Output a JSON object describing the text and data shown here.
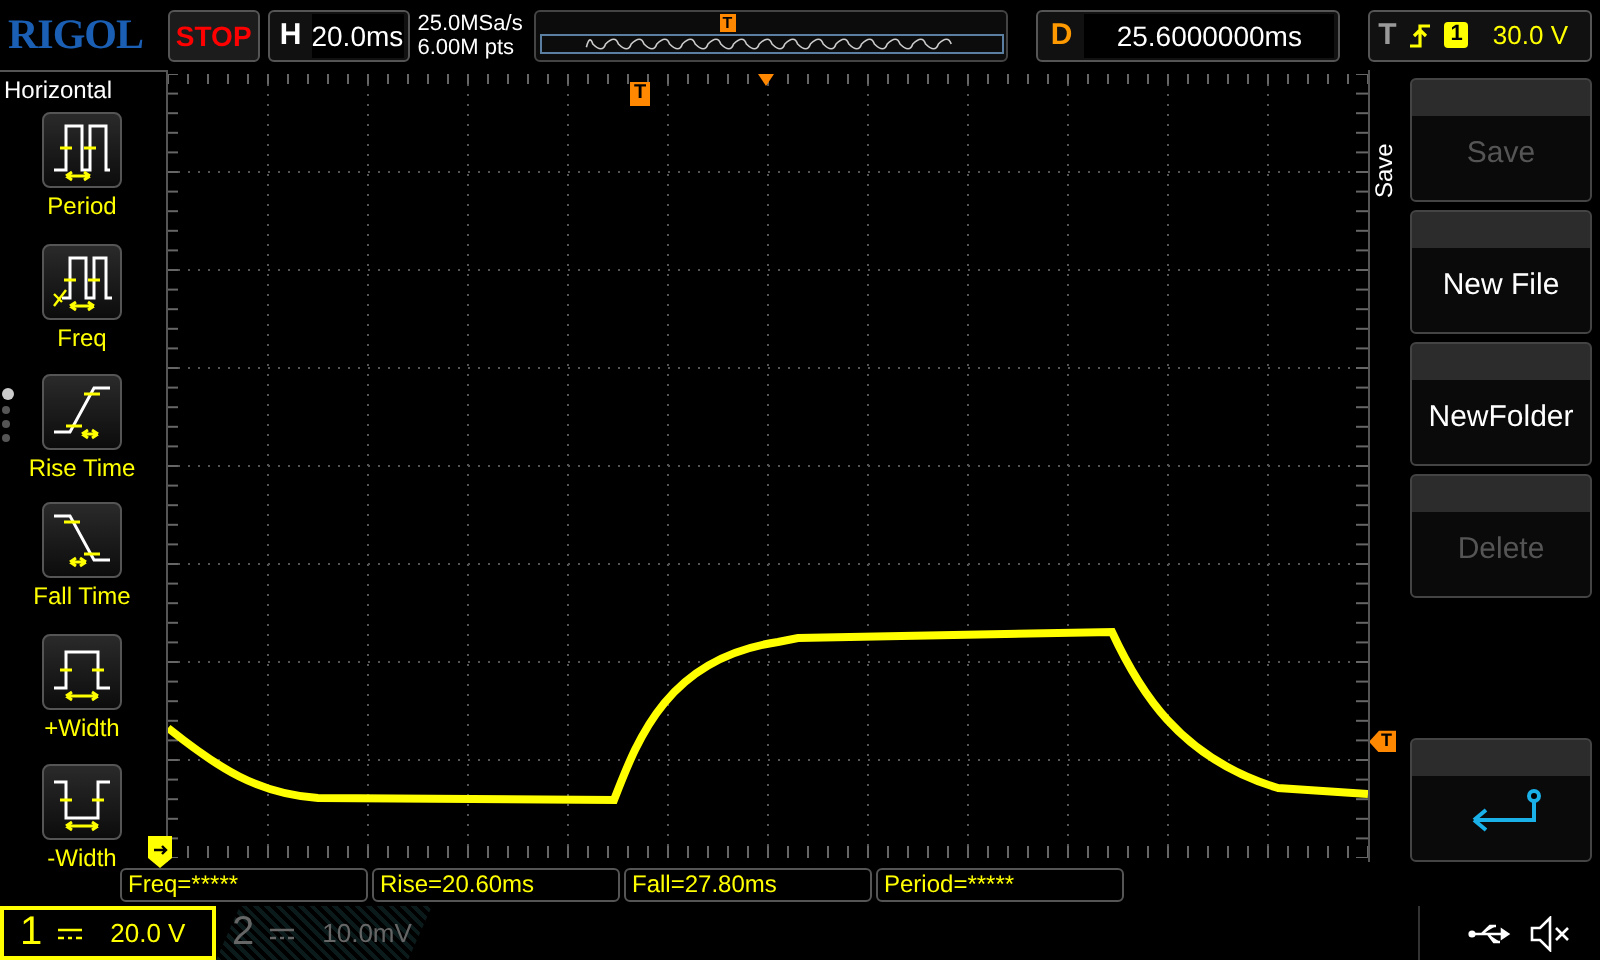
{
  "logo": "RIGOL",
  "run_status": "STOP",
  "timebase": {
    "label": "H",
    "value": "20.0ms"
  },
  "acquisition": {
    "sample_rate": "25.0MSa/s",
    "memory_depth": "6.00M pts"
  },
  "overview": {
    "trigger_marker": "T"
  },
  "delay": {
    "label": "D",
    "value": "25.6000000ms"
  },
  "trigger": {
    "label": "T",
    "source": "1",
    "level": "30.0 V"
  },
  "measure_panel": {
    "title": "Horizontal",
    "items": [
      {
        "kind": "period",
        "label": "Period"
      },
      {
        "kind": "freq",
        "label": "Freq"
      },
      {
        "kind": "rise",
        "label": "Rise Time"
      },
      {
        "kind": "fall",
        "label": "Fall Time"
      },
      {
        "kind": "pwidth",
        "label": "+Width"
      },
      {
        "kind": "nwidth",
        "label": "-Width"
      }
    ],
    "pages": [
      {
        "selected": true
      },
      {
        "selected": false
      },
      {
        "selected": false
      },
      {
        "selected": false
      }
    ]
  },
  "display": {
    "trigger_position_marker": "T",
    "trigger_level_marker": "T"
  },
  "menu": {
    "title": "Save",
    "items": [
      {
        "kind": "text",
        "label": "Save",
        "disabled": true
      },
      {
        "kind": "text",
        "label": "New File",
        "disabled": false
      },
      {
        "kind": "text",
        "label": "NewFolder",
        "disabled": false
      },
      {
        "kind": "text",
        "label": "Delete",
        "disabled": true
      },
      {
        "kind": "back"
      }
    ]
  },
  "measurements": [
    "Freq=*****",
    "Rise=20.60ms",
    "Fall=27.80ms",
    "Period=*****"
  ],
  "channels": [
    {
      "number": "1",
      "scale": "20.0 V",
      "selected": true
    },
    {
      "number": "2",
      "scale": "10.0mV",
      "selected": false
    }
  ]
}
